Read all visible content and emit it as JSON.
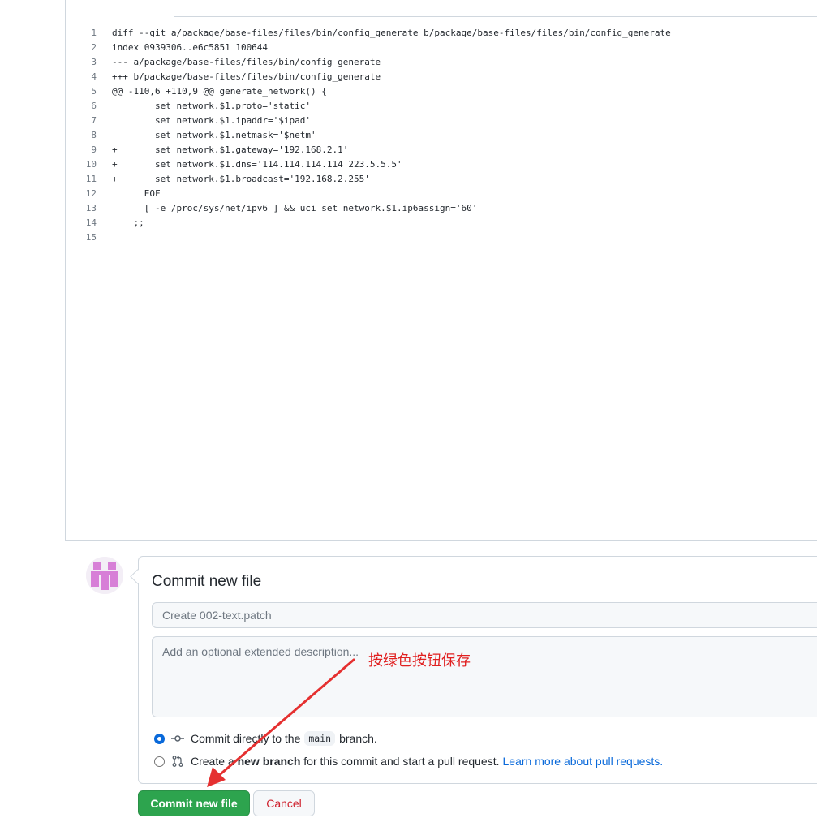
{
  "code_lines": [
    {
      "num": "1",
      "text": "diff --git a/package/base-files/files/bin/config_generate b/package/base-files/files/bin/config_generate"
    },
    {
      "num": "2",
      "text": "index 0939306..e6c5851 100644"
    },
    {
      "num": "3",
      "text": "--- a/package/base-files/files/bin/config_generate"
    },
    {
      "num": "4",
      "text": "+++ b/package/base-files/files/bin/config_generate"
    },
    {
      "num": "5",
      "text": "@@ -110,6 +110,9 @@ generate_network() {"
    },
    {
      "num": "6",
      "text": "        set network.$1.proto='static'"
    },
    {
      "num": "7",
      "text": "        set network.$1.ipaddr='$ipad'"
    },
    {
      "num": "8",
      "text": "        set network.$1.netmask='$netm'"
    },
    {
      "num": "9",
      "text": "+       set network.$1.gateway='192.168.2.1'"
    },
    {
      "num": "10",
      "text": "+       set network.$1.dns='114.114.114.114 223.5.5.5'"
    },
    {
      "num": "11",
      "text": "+       set network.$1.broadcast='192.168.2.255'"
    },
    {
      "num": "12",
      "text": "      EOF"
    },
    {
      "num": "13",
      "text": "      [ -e /proc/sys/net/ipv6 ] && uci set network.$1.ip6assign='60'"
    },
    {
      "num": "14",
      "text": "    ;;"
    },
    {
      "num": "15",
      "text": ""
    }
  ],
  "commit": {
    "title": "Commit new file",
    "summary_placeholder": "Create 002-text.patch",
    "description_placeholder": "Add an optional extended description...",
    "option_direct": {
      "prefix": "Commit directly to the",
      "branch": "main",
      "suffix": "branch."
    },
    "option_new_branch": {
      "prefix": "Create a",
      "bold": "new branch",
      "suffix": "for this commit and start a pull request.",
      "link": "Learn more about pull requests."
    },
    "submit_label": "Commit new file",
    "cancel_label": "Cancel"
  },
  "annotation": {
    "text": "按绿色按钮保存"
  },
  "colors": {
    "primary_button": "#2da44e",
    "cancel_text": "#cf222e",
    "link": "#0969da",
    "annotation": "#e02020"
  }
}
